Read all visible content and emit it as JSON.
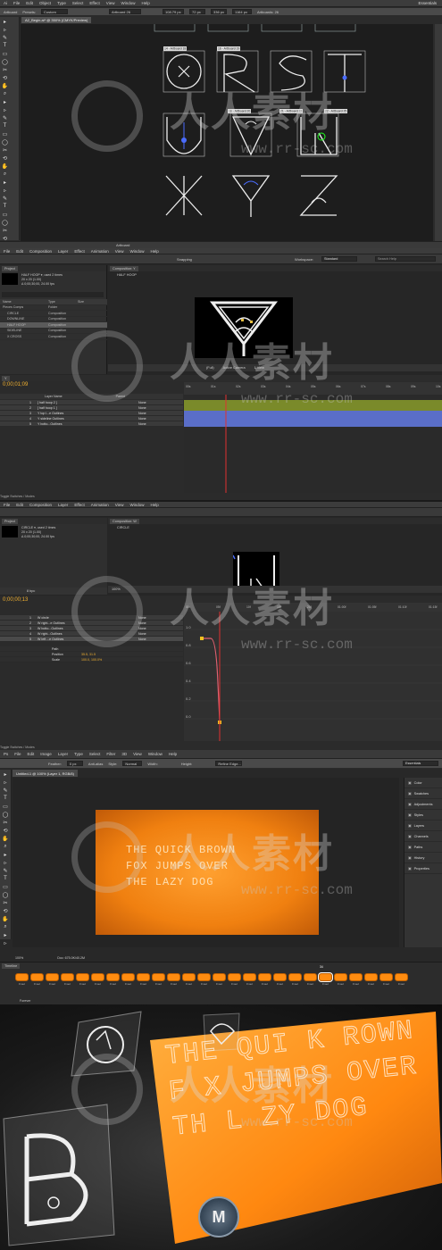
{
  "illustrator": {
    "menu": [
      "Ai",
      "File",
      "Edit",
      "Object",
      "Type",
      "Select",
      "Effect",
      "View",
      "Window",
      "Help"
    ],
    "workspace": "Essentials",
    "control": {
      "label": "Artboard",
      "preset_label": "Presets:",
      "preset_value": "Custom",
      "name_value": "Artboard 26",
      "w_value": "108.79 px",
      "h_value": "72 px",
      "x_value": "336 px",
      "y_value": "1164 px",
      "artboards_label": "Artboards: 26"
    },
    "doc_tab": "A2_Begin.ai* @ 350% (CMYK/Preview)",
    "artboard_labels": [
      "14 - Artboard 18",
      "16 - Artboard 19",
      "16 - Artboard 20",
      "21 - Artboard 22",
      "22 - Artboard 25"
    ],
    "status_text": "Artboard",
    "glyphs": [
      "Q",
      "R",
      "S",
      "T",
      "U",
      "V",
      "W",
      "X",
      "Y",
      "Z"
    ]
  },
  "ae1": {
    "menu": [
      "File",
      "Edit",
      "Composition",
      "Layer",
      "Effect",
      "Animation",
      "View",
      "Window",
      "Help"
    ],
    "workspace_label": "Workspace:",
    "workspace_value": "Standard",
    "search_placeholder": "Search Help",
    "snapping": "Snapping",
    "project_tab": "Project",
    "comp_tab": "Composition: Y",
    "comp_name": "HALF HOOP",
    "comp_info": [
      "HALF HOOP ▾, used 2 times",
      "20 x 20 (1.00)",
      "Δ 0;00;30;00, 24.00 fps"
    ],
    "project_header": [
      "Name",
      "Type",
      "Size"
    ],
    "project_items": [
      {
        "name": "Pieces Comps",
        "type": "Folder"
      },
      {
        "name": "CIRCLE",
        "type": "Composition"
      },
      {
        "name": "DOWNLINE",
        "type": "Composition"
      },
      {
        "name": "HALF HOOP",
        "type": "Composition"
      },
      {
        "name": "SIDELINE",
        "type": "Composition"
      },
      {
        "name": "X CROSS",
        "type": "Composition"
      }
    ],
    "viewer_controls": [
      "(Full)",
      "Active Camera",
      "1 View"
    ],
    "timecode": "0;00;01;09",
    "timeline_tab": "Y",
    "layer_header": [
      "Layer Name",
      "Parent"
    ],
    "layers": [
      {
        "num": "1",
        "name": "[ half hoop 2 ]",
        "parent": "None"
      },
      {
        "num": "2",
        "name": "[ half hoop 1 ]",
        "parent": "None"
      },
      {
        "num": "3",
        "name": "Y top l...e Outlines",
        "parent": "None"
      },
      {
        "num": "4",
        "name": "Y sideline Outlines",
        "parent": "None"
      },
      {
        "num": "5",
        "name": "Y botto...Outlines",
        "parent": "None"
      }
    ],
    "ruler": [
      "00s",
      "01s",
      "02s",
      "03s",
      "04s",
      "05s",
      "06s",
      "07s",
      "08s",
      "09s",
      "10s"
    ],
    "footer": "Toggle Switches / Modes"
  },
  "ae2": {
    "menu": [
      "File",
      "Edit",
      "Composition",
      "Layer",
      "Effect",
      "Animation",
      "View",
      "Window",
      "Help"
    ],
    "project_tab": "Project",
    "comp_tab": "Composition: W",
    "comp_name": "CIRCLE",
    "comp_info": [
      "CIRCLE ▾, used 2 times",
      "20 x 20 (1.00)",
      "Δ 0;00;30;00, 24.00 fps"
    ],
    "zoom": "100%",
    "bpc": "8 bpc",
    "timecode": "0;00;00;13",
    "layers": [
      {
        "num": "1",
        "name": "W circle",
        "parent": "None"
      },
      {
        "num": "2",
        "name": "W right...e Outlines",
        "parent": "None"
      },
      {
        "num": "3",
        "name": "W botto...Outlines",
        "parent": "None"
      },
      {
        "num": "4",
        "name": "W right...Outlines",
        "parent": "None"
      },
      {
        "num": "5",
        "name": "W left ...e Outlines",
        "parent": "None"
      }
    ],
    "props": [
      {
        "name": "Path",
        "value": ""
      },
      {
        "name": "Position",
        "value": "35.5, 31.5"
      },
      {
        "name": "Scale",
        "value": "100.0, 100.0%"
      }
    ],
    "graph_ticks": [
      "1.0",
      "0.8",
      "0.6",
      "0.4",
      "0.2",
      "0.0"
    ],
    "ruler": [
      "00f",
      "05f",
      "10f",
      "15f",
      "20f",
      "01:00f",
      "01:05f",
      "01:10f",
      "01:15f"
    ],
    "footer": "Toggle Switches / Modes"
  },
  "photoshop": {
    "menu": [
      "Ps",
      "File",
      "Edit",
      "Image",
      "Layer",
      "Type",
      "Select",
      "Filter",
      "3D",
      "View",
      "Window",
      "Help"
    ],
    "workspace": "Essentials",
    "options": {
      "feather_label": "Feather:",
      "feather_value": "0 px",
      "antialias": "Anti-alias",
      "style_label": "Style:",
      "style_value": "Normal",
      "width_label": "Width:",
      "height_label": "Height:",
      "refine": "Refine Edge..."
    },
    "doc_tab": "Untitled-1 @ 100% (Layer 1, RGB/8)",
    "canvas_text": [
      "THE QUICK BROWN",
      "FOX JUMPS OVER",
      "THE LAZY DOG"
    ],
    "side_panels": [
      "Color",
      "Swatches",
      "Adjustments",
      "Styles",
      "Layers",
      "Channels",
      "Paths",
      "History",
      "Properties"
    ],
    "zoom": "100%",
    "doc_size": "Doc: 675.0K/40.2M",
    "timeline_tab": "Timeline",
    "frame_times": [
      "0 sec",
      "0 sec",
      "0 sec",
      "0 sec",
      "0 sec",
      "0 sec",
      "0 sec",
      "0 sec",
      "0 sec",
      "0 sec",
      "0 sec",
      "0 sec",
      "0 sec",
      "0 sec",
      "0 sec",
      "0 sec",
      "0 sec",
      "0 sec",
      "0 sec",
      "0 sec",
      "0 sec",
      "0 sec",
      "0 sec",
      "0 sec",
      "0 sec",
      "0 sec"
    ],
    "selected_frame": "34",
    "loop": "Forever"
  },
  "final": {
    "lines": [
      "THE QUI K  ROWN",
      "F X JUMPS OVER",
      "TH  L ZY DOG"
    ]
  },
  "watermark": {
    "text": "人人素材",
    "url": "www.rr-sc.com"
  },
  "colors": {
    "orange": "#ff8c10",
    "ui_dark": "#3c3c3c",
    "glyph_stroke": "#4a6cff",
    "timeline_bar": "#5a6ec8",
    "playhead": "#e03030"
  }
}
